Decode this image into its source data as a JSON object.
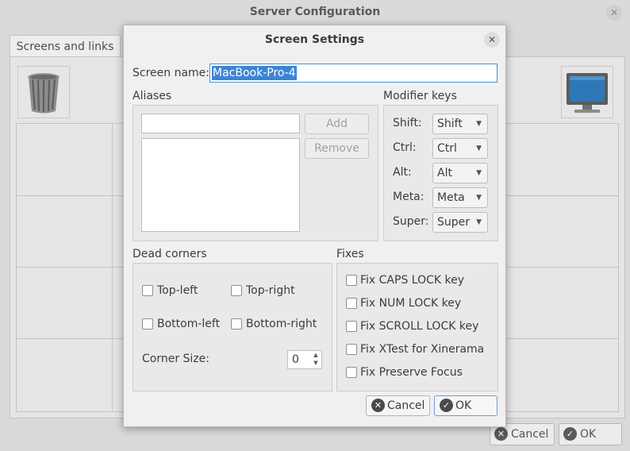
{
  "background": {
    "title": "Server Configuration",
    "tab": "Screens and links",
    "cancel_label": "Cancel",
    "ok_label": "OK"
  },
  "dialog": {
    "title": "Screen Settings",
    "screen_name_label": "Screen name:",
    "screen_name_value": "MacBook-Pro-4",
    "aliases_label": "Aliases",
    "add_label": "Add",
    "remove_label": "Remove",
    "modifier_keys": {
      "label": "Modifier keys",
      "rows": [
        {
          "label": "Shift:",
          "value": "Shift"
        },
        {
          "label": "Ctrl:",
          "value": "Ctrl"
        },
        {
          "label": "Alt:",
          "value": "Alt"
        },
        {
          "label": "Meta:",
          "value": "Meta"
        },
        {
          "label": "Super:",
          "value": "Super"
        }
      ]
    },
    "dead_corners": {
      "label": "Dead corners",
      "top_left": "Top-left",
      "top_right": "Top-right",
      "bottom_left": "Bottom-left",
      "bottom_right": "Bottom-right",
      "corner_size_label": "Corner Size:",
      "corner_size_value": "0"
    },
    "fixes": {
      "label": "Fixes",
      "items": [
        "Fix CAPS LOCK key",
        "Fix NUM LOCK key",
        "Fix SCROLL LOCK key",
        "Fix XTest for Xinerama",
        "Fix Preserve Focus"
      ]
    },
    "cancel_label": "Cancel",
    "ok_label": "OK"
  },
  "icons": {
    "close": "close-icon",
    "cancel": "cancel-icon",
    "ok": "check-icon",
    "trash": "trash-icon",
    "monitor": "monitor-icon"
  },
  "colors": {
    "selection": "#3d84d6",
    "focus_border": "#4a8fd3",
    "window_bg": "#f0f0f0"
  }
}
